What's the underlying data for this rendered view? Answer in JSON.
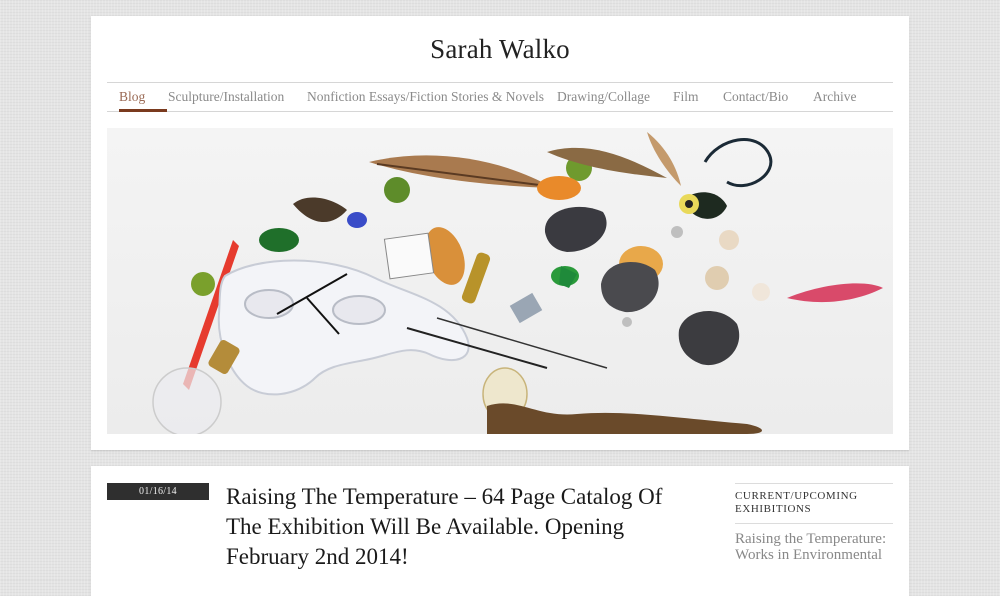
{
  "site": {
    "title": "Sarah Walko"
  },
  "nav": {
    "items": [
      {
        "label": "Blog",
        "active": true
      },
      {
        "label": "Sculpture/Installation",
        "active": false
      },
      {
        "label": "Nonfiction Essays/Fiction Stories & Novels",
        "active": false
      },
      {
        "label": "Drawing/Collage",
        "active": false
      },
      {
        "label": "Film",
        "active": false
      },
      {
        "label": "Contact/Bio",
        "active": false
      },
      {
        "label": "Archive",
        "active": false
      }
    ]
  },
  "post": {
    "date": "01/16/14",
    "title": "Raising The Temperature – 64 Page Catalog Of The Exhibition Will Be Available. Opening February 2nd 2014!"
  },
  "sidebar": {
    "heading": "CURRENT/UPCOMING EXHIBITIONS",
    "link": "Raising the Temperature: Works in Environmental"
  },
  "colors": {
    "nav_active_underline": "#7a3a1e",
    "date_badge_bg": "#2f2f2f",
    "page_bg": "#e4e4e4"
  }
}
